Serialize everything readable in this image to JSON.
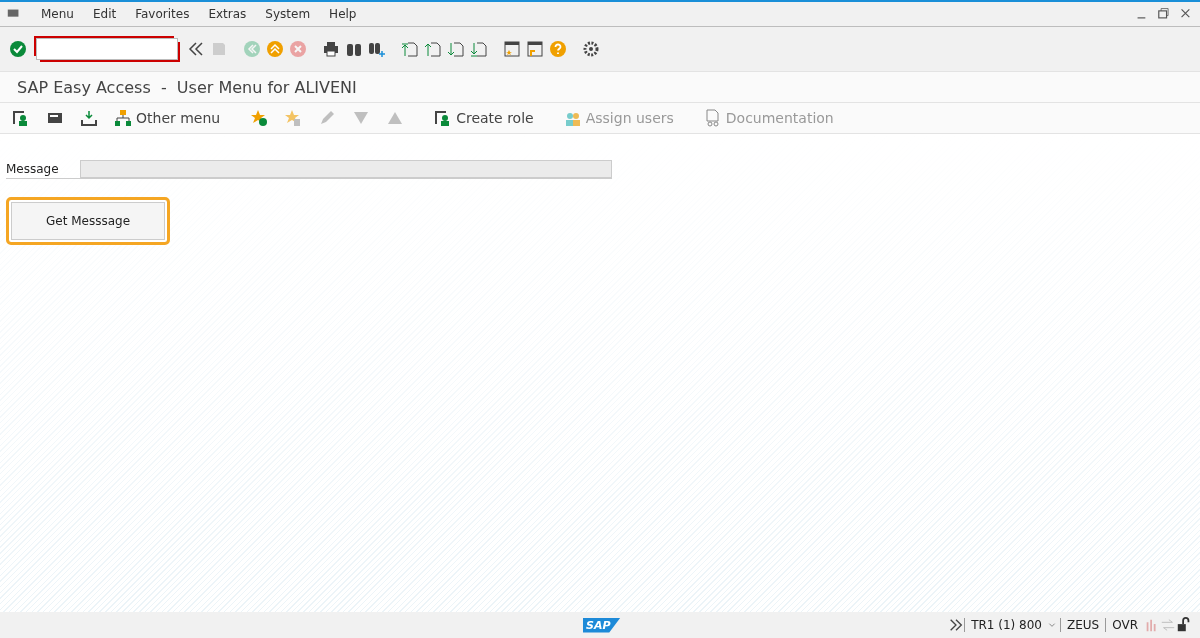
{
  "menu_bar": {
    "items": [
      "Menu",
      "Edit",
      "Favorites",
      "Extras",
      "System",
      "Help"
    ]
  },
  "standard_toolbar": {
    "buttons": [
      {
        "disabled": false
      },
      {
        "disabled": true
      },
      {
        "disabled": true
      },
      {
        "disabled": false
      },
      {
        "disabled": true
      },
      {
        "disabled": false
      },
      {
        "disabled": false
      },
      {
        "disabled": false
      },
      {
        "disabled": false
      },
      {
        "disabled": false
      },
      {
        "disabled": false
      },
      {
        "disabled": false
      },
      {
        "disabled": false
      },
      {
        "disabled": false
      },
      {
        "disabled": false
      },
      {
        "disabled": false
      }
    ]
  },
  "title": "SAP Easy Access  -  User Menu for ALIVENI",
  "app_toolbar": [
    {
      "disabled": false
    },
    {
      "disabled": false
    },
    {
      "disabled": false
    },
    {
      "label": "Other menu",
      "disabled": false
    },
    {
      "disabled": false
    },
    {
      "disabled": true
    },
    {
      "disabled": true
    },
    {
      "disabled": true
    },
    {
      "disabled": true
    },
    {
      "label": "Create role",
      "disabled": false
    },
    {
      "label": "Assign users",
      "disabled": true
    },
    {
      "label": "Documentation",
      "disabled": true
    }
  ],
  "form": {
    "message_label": "Message",
    "button": "Get Messsage"
  },
  "status_bar": {
    "logo": "SAP",
    "system": "TR1 (1) 800",
    "server": "ZEUS",
    "mode": "OVR"
  }
}
